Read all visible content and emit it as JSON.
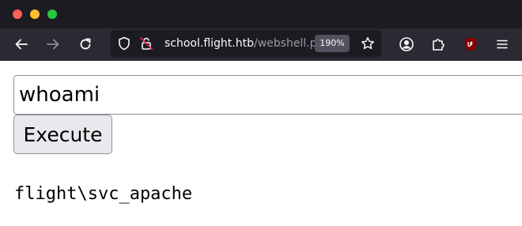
{
  "browser": {
    "url": {
      "host": "school.flight.htb",
      "path": "/webshell.p"
    },
    "zoom": "190%",
    "icons": {
      "back": "arrow-left-icon",
      "forward": "arrow-right-icon",
      "reload": "reload-icon",
      "shield": "shield-icon",
      "insecure_lock": "insecure-lock-icon",
      "bookmark": "star-icon",
      "account": "account-icon",
      "extensions": "puzzle-icon",
      "ublock": "ublock-icon",
      "menu": "hamburger-menu-icon"
    }
  },
  "page": {
    "command_input_value": "whoami",
    "execute_label": "Execute",
    "output": "flight\\svc_apache"
  }
}
